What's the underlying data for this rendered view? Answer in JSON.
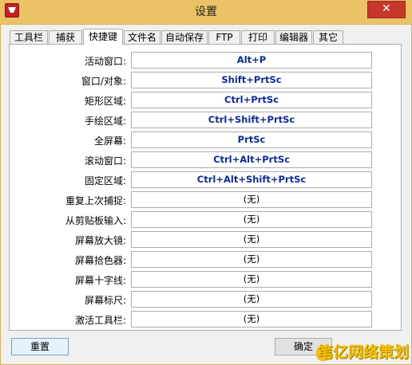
{
  "window": {
    "title": "设置",
    "close_glyph": "✕"
  },
  "tabs": [
    {
      "label": "工具栏"
    },
    {
      "label": "捕获"
    },
    {
      "label": "快捷键"
    },
    {
      "label": "文件名"
    },
    {
      "label": "自动保存"
    },
    {
      "label": "FTP"
    },
    {
      "label": "打印"
    },
    {
      "label": "编辑器"
    },
    {
      "label": "其它"
    }
  ],
  "active_tab": "快捷键",
  "hotkeys": [
    {
      "label": "活动窗口:",
      "value": "Alt+P"
    },
    {
      "label": "窗口/对象:",
      "value": "Shift+PrtSc"
    },
    {
      "label": "矩形区域:",
      "value": "Ctrl+PrtSc"
    },
    {
      "label": "手绘区域:",
      "value": "Ctrl+Shift+PrtSc"
    },
    {
      "label": "全屏幕:",
      "value": "PrtSc"
    },
    {
      "label": "滚动窗口:",
      "value": "Ctrl+Alt+PrtSc"
    },
    {
      "label": "固定区域:",
      "value": "Ctrl+Alt+Shift+PrtSc"
    },
    {
      "label": "重复上次捕捉:",
      "value": "(无)"
    },
    {
      "label": "从剪贴板输入:",
      "value": "(无)"
    },
    {
      "label": "屏幕放大镜:",
      "value": "(无)"
    },
    {
      "label": "屏幕拾色器:",
      "value": "(无)"
    },
    {
      "label": "屏幕十字线:",
      "value": "(无)"
    },
    {
      "label": "屏幕标尺:",
      "value": "(无)"
    },
    {
      "label": "激活工具栏:",
      "value": "(无)"
    }
  ],
  "buttons": {
    "reset": "重置",
    "ok": "确定"
  },
  "watermark": "笔亿网络策划",
  "colors": {
    "titlebar": "#ecc266",
    "hotkey_text": "#0c2ba1",
    "close": "#c7362b"
  }
}
